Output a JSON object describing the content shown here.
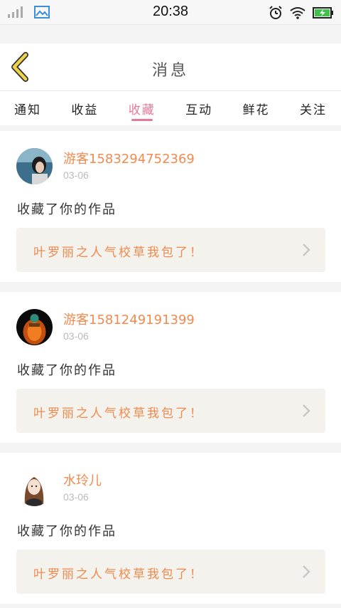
{
  "status_bar": {
    "time": "20:38",
    "icons": [
      "signal-icon",
      "gallery-icon",
      "alarm-icon",
      "wifi-icon",
      "battery-icon"
    ]
  },
  "header": {
    "title": "消息",
    "back_icon": "chevron-left-icon"
  },
  "tabs": [
    {
      "label": "通知",
      "active": false
    },
    {
      "label": "收益",
      "active": false
    },
    {
      "label": "收藏",
      "active": true
    },
    {
      "label": "互动",
      "active": false
    },
    {
      "label": "鲜花",
      "active": false
    },
    {
      "label": "关注",
      "active": false
    }
  ],
  "messages": [
    {
      "user": "游客1583294752369",
      "date": "03-06",
      "action": "收藏了你的作品",
      "work": "叶罗丽之人气校草我包了！"
    },
    {
      "user": "游客1581249191399",
      "date": "03-06",
      "action": "收藏了你的作品",
      "work": "叶罗丽之人气校草我包了！"
    },
    {
      "user": "水玲儿",
      "date": "03-06",
      "action": "收藏了你的作品",
      "work": "叶罗丽之人气校草我包了！"
    }
  ],
  "colors": {
    "accent": "#e8789a",
    "username": "#f08a4e",
    "back_arrow": "#f0d24a",
    "card_link_bg": "#f3f2ec"
  }
}
